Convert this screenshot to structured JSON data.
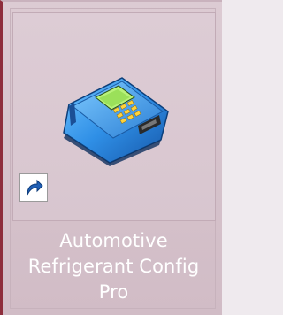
{
  "shortcut": {
    "name_lines": [
      "Automotive",
      "Refrigerant Config",
      "Pro"
    ],
    "icon": "refrigerant-analyzer-device-icon",
    "overlay_icon": "shortcut-arrow-icon",
    "selected": true
  },
  "colors": {
    "tile_background": "#d6c3cc",
    "selection_border": "#8e2d3c",
    "label_text": "#ffffff",
    "device_body": "#2f8fe6"
  }
}
